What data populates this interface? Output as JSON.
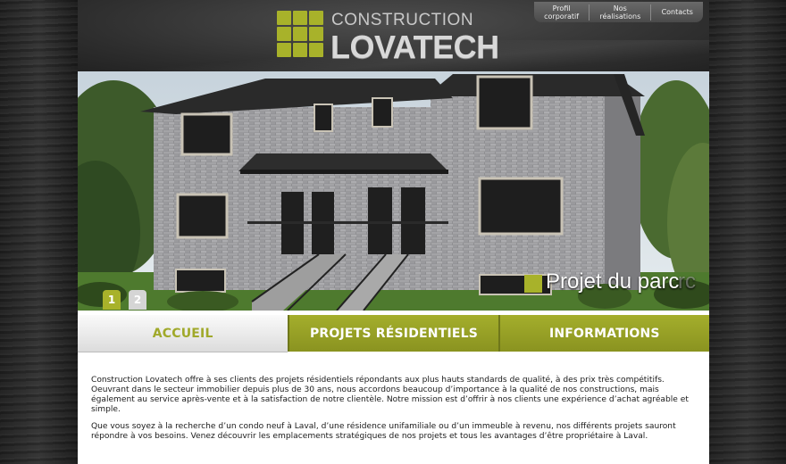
{
  "brand": {
    "line1": "CONSTRUCTION",
    "line2": "LOVATECH",
    "accent_color": "#a8b22a"
  },
  "topnav": [
    {
      "label": "Profil\ncorporatif"
    },
    {
      "label": "Nos\nréalisations"
    },
    {
      "label": "Contacts"
    }
  ],
  "hero": {
    "caption": "Projet du parc",
    "caption_fade": "rc",
    "slides": [
      {
        "label": "1",
        "active": true
      },
      {
        "label": "2",
        "active": false
      }
    ]
  },
  "mainnav": [
    {
      "label": "ACCUEIL",
      "active": true
    },
    {
      "label": "PROJETS RÉSIDENTIELS",
      "active": false
    },
    {
      "label": "INFORMATIONS",
      "active": false
    }
  ],
  "content": {
    "paragraph1": "Construction Lovatech offre à ses clients des projets résidentiels répondants aux plus hauts standards de qualité, à des prix très compétitifs.  Oeuvrant dans le secteur immobilier depuis plus de 30 ans, nous accordons beaucoup d’importance à la qualité de nos constructions, mais également au service après-vente et à la satisfaction de notre clientèle. Notre mission est d’offrir à nos clients une expérience d’achat agréable et simple.",
    "paragraph2": "Que vous soyez à la recherche d’un condo neuf à Laval, d’une résidence unifamiliale ou d’un immeuble à revenu, nos différents projets sauront répondre à vos besoins. Venez découvrir les emplacements stratégiques de nos projets et tous les avantages d’être propriétaire à Laval."
  }
}
